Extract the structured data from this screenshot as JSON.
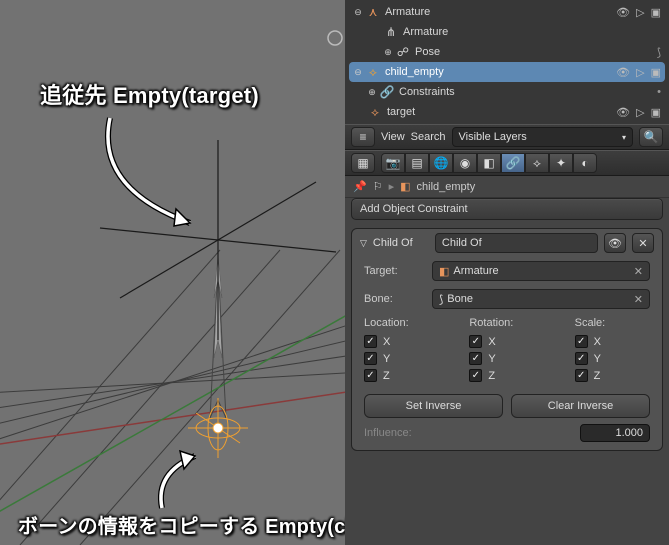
{
  "annotations": {
    "top": "追従先 Empty(target)",
    "bottom": "ボーンの情報をコピーする Empty(child_empty)"
  },
  "outliner": {
    "root": "Armature",
    "armature_data": "Armature",
    "pose": "Pose",
    "child_empty": "child_empty",
    "constraints": "Constraints",
    "target": "target"
  },
  "outliner_header": {
    "view": "View",
    "search": "Search",
    "filter": "Visible Layers"
  },
  "breadcrumb": {
    "object": "child_empty"
  },
  "constraint_panel": {
    "add": "Add Object Constraint",
    "name_label": "Child Of",
    "name_value": "Child Of",
    "target_label": "Target:",
    "target_value": "Armature",
    "bone_label": "Bone:",
    "bone_value": "Bone",
    "location": "Location:",
    "rotation": "Rotation:",
    "scale": "Scale:",
    "x": "X",
    "y": "Y",
    "z": "Z",
    "set_inverse": "Set Inverse",
    "clear_inverse": "Clear Inverse",
    "influence_label": "Influence:",
    "influence_value": "1.000"
  }
}
